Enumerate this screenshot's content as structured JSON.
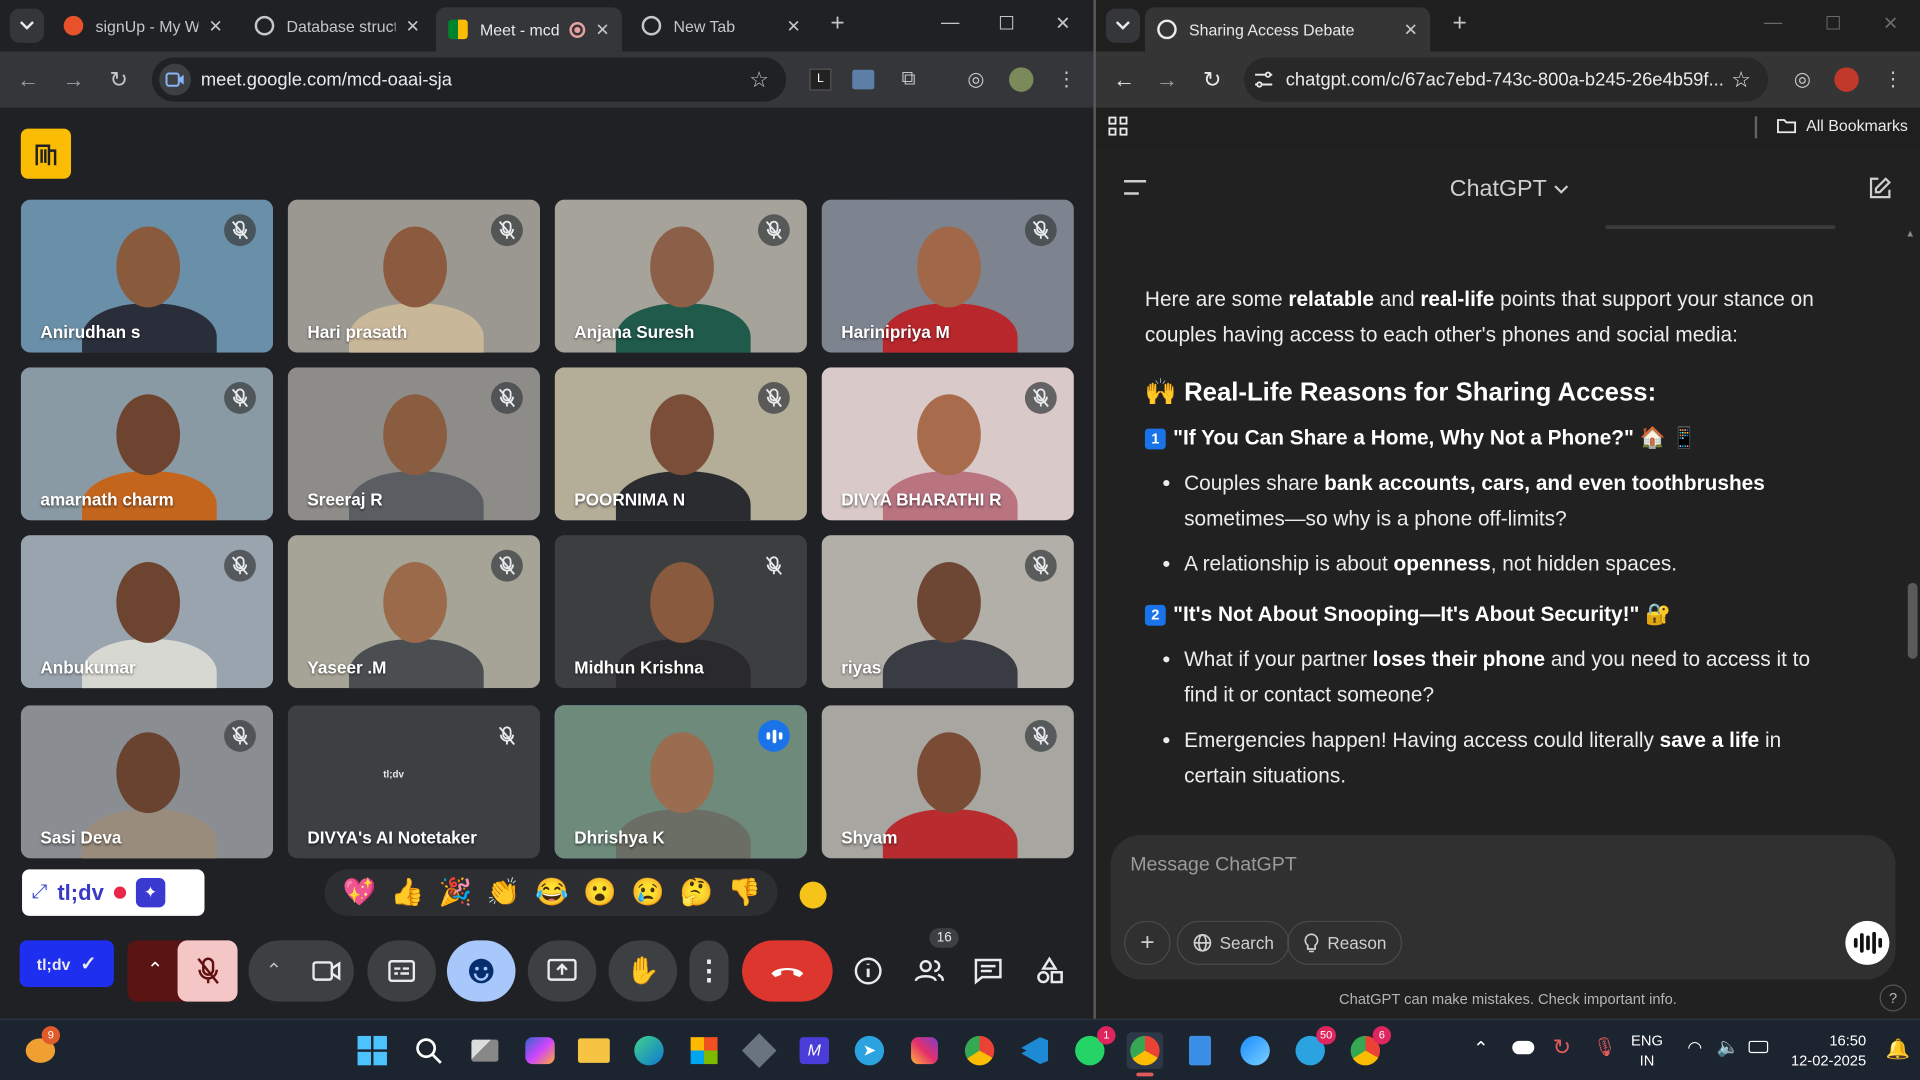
{
  "left_browser": {
    "tabs": [
      {
        "label": "signUp - My We",
        "icon": "signup-icon"
      },
      {
        "label": "Database struct",
        "icon": "openai-icon"
      },
      {
        "label": "Meet - mcd",
        "icon": "meet-icon"
      },
      {
        "label": "New Tab",
        "icon": "chrome-icon"
      }
    ],
    "url": "meet.google.com/mcd-oaai-sja"
  },
  "right_browser": {
    "tabs": [
      {
        "label": "Sharing Access Debate",
        "icon": "openai-icon"
      }
    ],
    "url": "chatgpt.com/c/67ac7ebd-743c-800a-b245-26e4b59f...",
    "bookmarks_label": "All Bookmarks"
  },
  "meet": {
    "participants": [
      {
        "name": "Anirudhan s",
        "bg": "#6a8fa8",
        "shirt": "#2a2e3a",
        "skin": "#8a5a3c"
      },
      {
        "name": "Hari prasath",
        "bg": "#9a9890",
        "shirt": "#c9b79a",
        "skin": "#8c5a3e"
      },
      {
        "name": "Anjana Suresh",
        "bg": "#a6a39a",
        "shirt": "#1f5a4a",
        "skin": "#8c6048"
      },
      {
        "name": "Harinipriya M",
        "bg": "#7d8490",
        "shirt": "#b8272c",
        "skin": "#a06848"
      },
      {
        "name": "amarnath charm",
        "bg": "#8a9aa4",
        "shirt": "#c4651e",
        "skin": "#6e4430"
      },
      {
        "name": "Sreeraj R",
        "bg": "#8e8c88",
        "shirt": "#5a5e62",
        "skin": "#8a5c40"
      },
      {
        "name": "POORNIMA N",
        "bg": "#b4ad98",
        "shirt": "#2a2c30",
        "skin": "#7a4e38"
      },
      {
        "name": "DIVYA BHARATHI R",
        "bg": "#d9c9c8",
        "shirt": "#b97480",
        "skin": "#a86c4c"
      },
      {
        "name": "Anbukumar",
        "bg": "#9aa4ae",
        "shirt": "#d8d8d2",
        "skin": "#6c4430"
      },
      {
        "name": "Yaseer .M",
        "bg": "#a6a496",
        "shirt": "#4a4e50",
        "skin": "#9a6a4a"
      },
      {
        "name": "Midhun Krishna",
        "bg": "#3c3e40",
        "shirt": "#2a2a2c",
        "skin": "#8a5a3e"
      },
      {
        "name": "riyas",
        "bg": "#b2aea8",
        "shirt": "#3a3c44",
        "skin": "#6e4634"
      },
      {
        "name": "Sasi Deva",
        "bg": "#8a8e92",
        "shirt": "#9a8c7c",
        "skin": "#6a4330"
      },
      {
        "name": "DIVYA's AI Notetaker",
        "bg": "#3c4043",
        "shirt": "",
        "skin": ""
      },
      {
        "name": "Dhrishya K",
        "bg": "#6e8a7a",
        "shirt": "#6a6e64",
        "skin": "#9a6c50"
      },
      {
        "name": "Shyam",
        "bg": "#a8a6a0",
        "shirt": "#b82c30",
        "skin": "#7a4c36"
      }
    ],
    "notetaker_logo_text": "tl;dv",
    "tldv_label": "tl;dv",
    "tldv_button_label": "tl;dv",
    "participant_count": "16",
    "reactions": [
      "💖",
      "👍",
      "🎉",
      "👏",
      "😂",
      "😮",
      "😢",
      "🤔",
      "👎"
    ]
  },
  "chat": {
    "model_title": "ChatGPT",
    "intro_parts": [
      "Here are some ",
      "relatable",
      " and ",
      "real-life",
      " points that support your stance on couples having access to each other's phones and social media:"
    ],
    "heading": "Real-Life Reasons for Sharing Access:",
    "point1_title": "\"If You Can Share a Home, Why Not a Phone?\"",
    "p1b1_a": "Couples share ",
    "p1b1_b": "bank accounts, cars, and even toothbrushes",
    "p1b1_c": " sometimes—so why is a phone off-limits?",
    "p1b2_a": "A relationship is about ",
    "p1b2_b": "openness",
    "p1b2_c": ", not hidden spaces.",
    "point2_title": "\"It's Not About Snooping—It's About Security!\"",
    "p2b1_a": "What if your partner ",
    "p2b1_b": "loses their phone",
    "p2b1_c": " and you need to access it to find it or contact someone?",
    "p2b2_a": "Emergencies happen! Having access could literally ",
    "p2b2_b": "save a life",
    "p2b2_c": " in certain situations.",
    "composer_placeholder": "Message ChatGPT",
    "search_label": "Search",
    "reason_label": "Reason",
    "disclaimer": "ChatGPT can make mistakes. Check important info."
  },
  "taskbar": {
    "lang_line1": "ENG",
    "lang_line2": "IN",
    "time": "16:50",
    "date": "12-02-2025",
    "weather_badge": "9",
    "whatsapp_badge": "1",
    "telegram_badge": "50",
    "chrome_badge": "6"
  }
}
